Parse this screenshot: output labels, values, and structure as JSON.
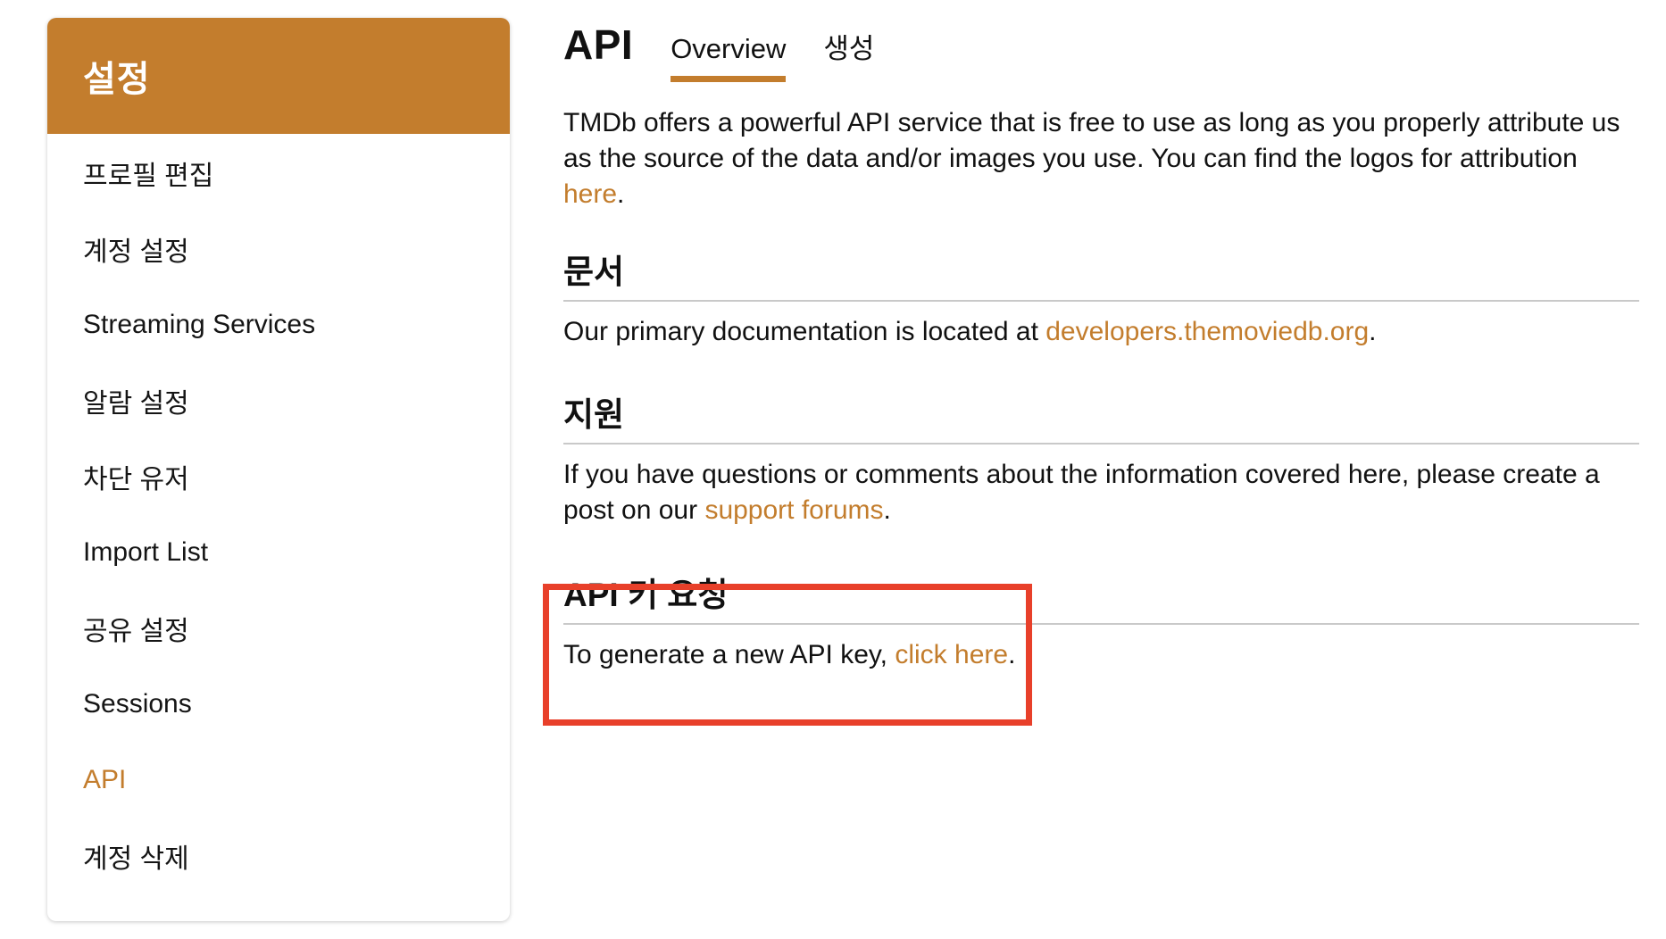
{
  "sidebar": {
    "title": "설정",
    "items": [
      {
        "label": "프로필 편집"
      },
      {
        "label": "계정 설정"
      },
      {
        "label": "Streaming Services"
      },
      {
        "label": "알람 설정"
      },
      {
        "label": "차단 유저"
      },
      {
        "label": "Import List"
      },
      {
        "label": "공유 설정"
      },
      {
        "label": "Sessions"
      },
      {
        "label": "API",
        "active": true
      },
      {
        "label": "계정 삭제"
      }
    ]
  },
  "header": {
    "title": "API",
    "tabs": [
      {
        "label": "Overview",
        "active": true
      },
      {
        "label": "생성"
      }
    ]
  },
  "intro": {
    "text": "TMDb offers a powerful API service that is free to use as long as you properly attribute us as the source of the data and/or images you use. You can find the logos for attribution ",
    "link": "here",
    "suffix": "."
  },
  "docs": {
    "heading": "문서",
    "text": "Our primary documentation is located at ",
    "link": "developers.themoviedb.org",
    "suffix": "."
  },
  "support": {
    "heading": "지원",
    "text": "If you have questions or comments about the information covered here, please create a post on our ",
    "link": "support forums",
    "suffix": "."
  },
  "apikey": {
    "heading": "API 키 요청",
    "text": "To generate a new API key, ",
    "link": "click here",
    "suffix": "."
  },
  "colors": {
    "accent": "#c37d2d",
    "highlight_border": "#e8402a"
  }
}
